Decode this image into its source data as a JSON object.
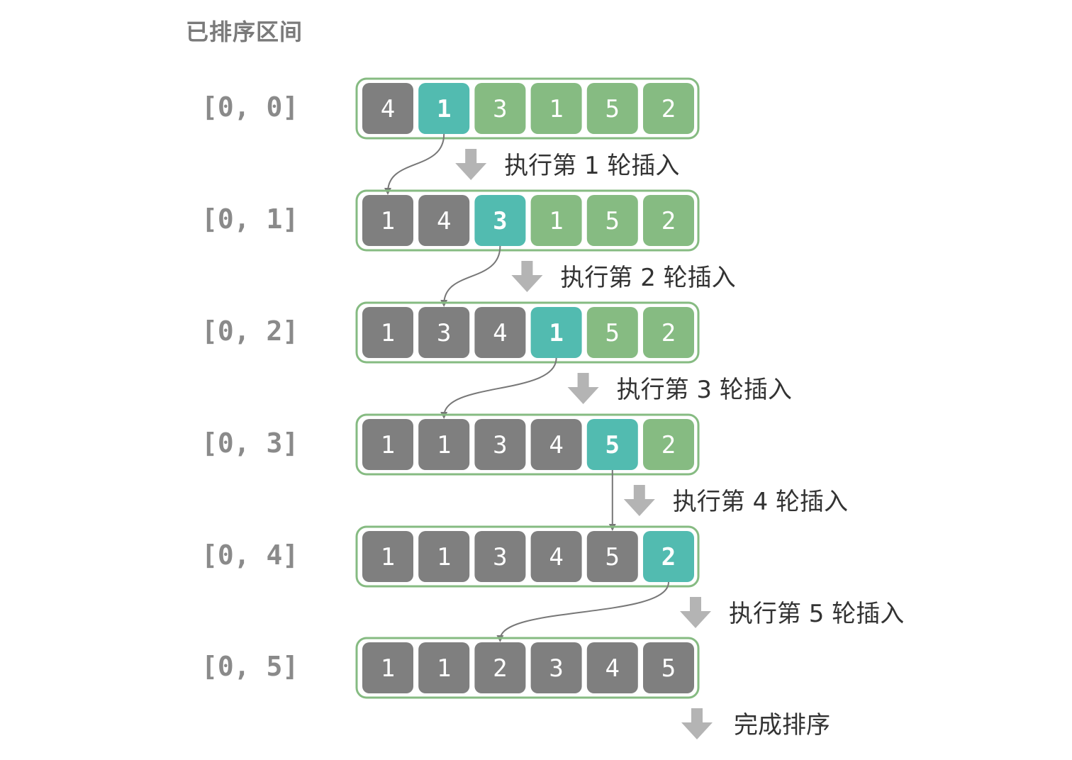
{
  "header": "已排序区间",
  "colors": {
    "sorted": "#7f7f7f",
    "current": "#52bbb0",
    "unsorted": "#86bb82",
    "frame": "#86bb82",
    "arrow": "#b4b4b4",
    "curve": "#777777"
  },
  "rows": [
    {
      "range": "[0, 0]",
      "values": [
        "4",
        "1",
        "3",
        "1",
        "5",
        "2"
      ],
      "sorted_count": 1,
      "current": 1,
      "insert_at": 0,
      "step": "执行第 1 轮插入"
    },
    {
      "range": "[0, 1]",
      "values": [
        "1",
        "4",
        "3",
        "1",
        "5",
        "2"
      ],
      "sorted_count": 2,
      "current": 2,
      "insert_at": 1,
      "step": "执行第 2 轮插入"
    },
    {
      "range": "[0, 2]",
      "values": [
        "1",
        "3",
        "4",
        "1",
        "5",
        "2"
      ],
      "sorted_count": 3,
      "current": 3,
      "insert_at": 1,
      "step": "执行第 3 轮插入"
    },
    {
      "range": "[0, 3]",
      "values": [
        "1",
        "1",
        "3",
        "4",
        "5",
        "2"
      ],
      "sorted_count": 4,
      "current": 4,
      "insert_at": 4,
      "step": "执行第 4 轮插入"
    },
    {
      "range": "[0, 4]",
      "values": [
        "1",
        "1",
        "3",
        "4",
        "5",
        "2"
      ],
      "sorted_count": 5,
      "current": 5,
      "insert_at": 2,
      "step": "执行第 5 轮插入"
    },
    {
      "range": "[0, 5]",
      "values": [
        "1",
        "1",
        "2",
        "3",
        "4",
        "5"
      ],
      "sorted_count": 6,
      "current": null,
      "insert_at": null,
      "step": "完成排序"
    }
  ]
}
